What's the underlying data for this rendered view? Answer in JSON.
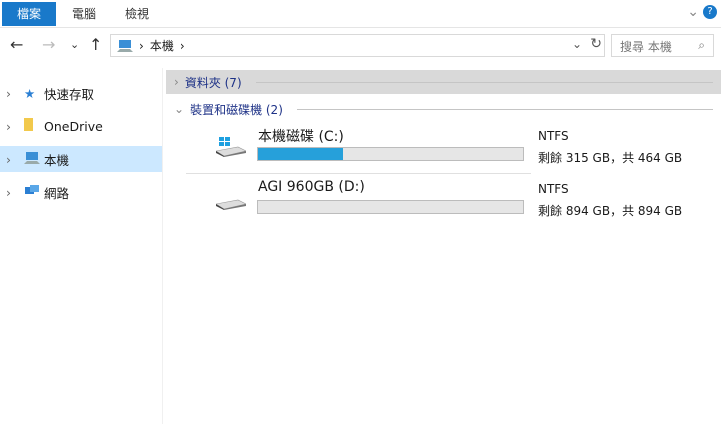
{
  "ribbon": {
    "tabs": [
      "檔案",
      "電腦",
      "檢視"
    ],
    "help": "?"
  },
  "nav": {
    "back": "←",
    "forward": "→",
    "recent": "⌄",
    "up": "↑",
    "path": [
      "本機"
    ],
    "search_placeholder": "搜尋 本機"
  },
  "sidebar": {
    "items": [
      {
        "label": "快速存取",
        "icon": "star-icon"
      },
      {
        "label": "OneDrive",
        "icon": "folder-icon"
      },
      {
        "label": "本機",
        "icon": "computer-icon",
        "selected": true
      },
      {
        "label": "網路",
        "icon": "network-icon"
      }
    ]
  },
  "main": {
    "folders_group": "資料夾 (7)",
    "devices_group": "裝置和磁碟機 (2)",
    "drives": [
      {
        "name": "本機磁碟 (C:)",
        "fs": "NTFS",
        "free": "剩餘 315 GB，共 464 GB",
        "used_fraction": 0.32,
        "os": true
      },
      {
        "name": "AGI 960GB (D:)",
        "fs": "NTFS",
        "free": "剩餘 894 GB，共 894 GB",
        "used_fraction": 0.0,
        "os": false
      }
    ]
  },
  "colors": {
    "accent": "#1979ca",
    "bar": "#26a0da"
  }
}
